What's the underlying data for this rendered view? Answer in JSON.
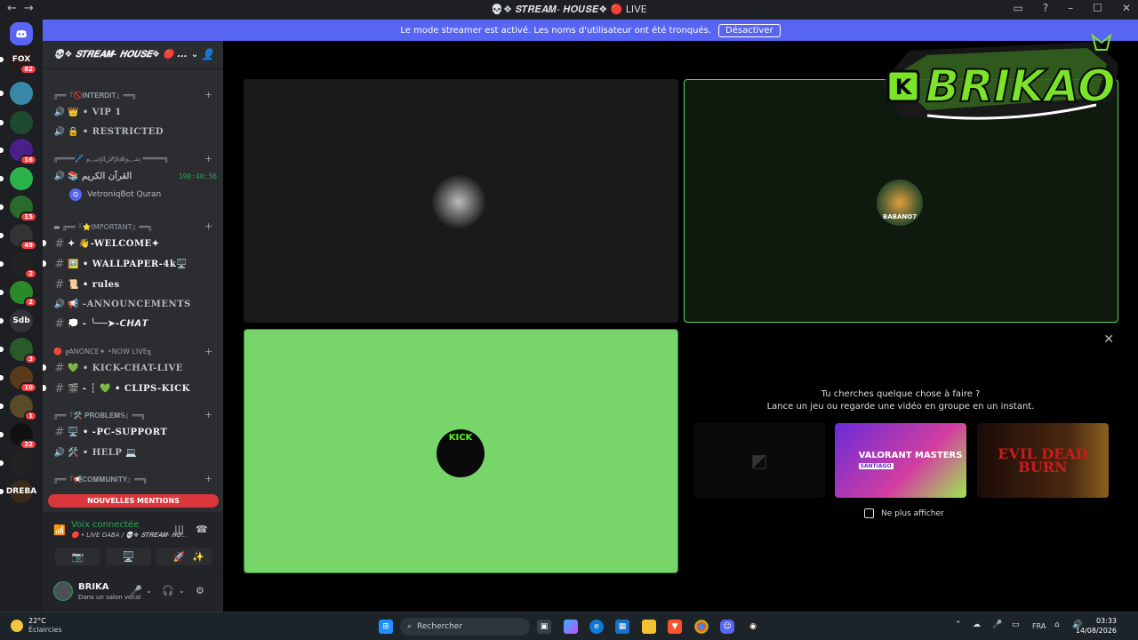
{
  "window": {
    "title": "💀❖ 𝑺𝑻𝑹𝑬𝑨𝑴- 𝑯𝑶𝑼𝑺𝑬❖ 🔴 LIVE",
    "nav_back": "←",
    "nav_forward": "→",
    "controls": [
      "▭",
      "?",
      "–",
      "☐",
      "✕"
    ]
  },
  "banner": {
    "text": "Le mode streamer est activé. Les noms d'utilisateur ont été tronqués.",
    "button": "Désactiver"
  },
  "guilds": [
    {
      "label": "FOX",
      "badge": "82",
      "color": "#2a1a1a"
    },
    {
      "label": "",
      "badge": "",
      "color": "#3a88a8"
    },
    {
      "label": "",
      "badge": "",
      "color": "#1e4a30"
    },
    {
      "label": "",
      "badge": "16",
      "color": "#4a1f8a"
    },
    {
      "label": "",
      "badge": "",
      "color": "#2bb24a"
    },
    {
      "label": "",
      "badge": "15",
      "color": "#2a6a2a"
    },
    {
      "label": "",
      "badge": "49",
      "color": "#333"
    },
    {
      "label": "",
      "badge": "2",
      "color": "#222"
    },
    {
      "label": "",
      "badge": "2",
      "color": "#2a8a2a"
    },
    {
      "label": "Sdb",
      "badge": "",
      "color": "#313338"
    },
    {
      "label": "",
      "badge": "3",
      "color": "#2a5a2a"
    },
    {
      "label": "",
      "badge": "10",
      "color": "#5a3a1a"
    },
    {
      "label": "",
      "badge": "1",
      "color": "#5a4a2a"
    },
    {
      "label": "",
      "badge": "22",
      "color": "#111"
    },
    {
      "label": "",
      "badge": "",
      "color": "#222"
    },
    {
      "label": "DREBA",
      "badge": "",
      "color": "#3a2a1a"
    }
  ],
  "server": {
    "name": "💀❖ 𝑺𝑻𝑹𝑬𝑨𝑴- 𝑯𝑶𝑼𝑺𝑬❖ 🔴 ..."
  },
  "categories": [
    {
      "label": "╔══『🚫𝐈𝐍𝐓𝐄𝐑𝐃𝐈𝐓』══╗",
      "plus": "+"
    },
    {
      "label": "╔════🖊️ ﷽ ═════╗",
      "plus": "+"
    },
    {
      "label": "▬ ╔══『⭐IMPORTANT』══╗",
      "plus": "+"
    },
    {
      "label": "🔴 ╔ANONCE✦ •NOW LIVE╗",
      "plus": "+"
    },
    {
      "label": "╔══『🛠️ 𝐏𝐑𝐎𝐁𝐋𝐄𝐌𝐒』══╗",
      "plus": "+"
    },
    {
      "label": "╔══『📢𝐂𝐎𝐌𝐌𝐔𝐍𝐈𝐓𝐘』══╗",
      "plus": "+"
    }
  ],
  "channels": [
    {
      "icon": "🔊",
      "name": "👑 • VIP 1"
    },
    {
      "icon": "🔊",
      "name": "🔒 • RESTRICTED"
    },
    {
      "icon": "🔊",
      "name": "📚 القرآن الكريم",
      "timer": "190:40:56"
    },
    {
      "icon": "#",
      "name": "✦ 👋-WELCOME✦"
    },
    {
      "icon": "#",
      "name": "🖼️ • WALLPAPER-4k🖥️"
    },
    {
      "icon": "#",
      "name": "📜 • rules"
    },
    {
      "icon": "🔊",
      "name": "📢 -ANNOUNCEMENTS"
    },
    {
      "icon": "#",
      "name": "💭 - ╰──➤-𝘾𝙃𝘼𝙏"
    },
    {
      "icon": "#",
      "name": "💚 • KICK-CHAT-LIVE"
    },
    {
      "icon": "#",
      "name": "🎬 - ┆ 💚 • CLIPS-KICK"
    },
    {
      "icon": "#",
      "name": "🖥️ • -PC-SUPPORT"
    },
    {
      "icon": "🔊",
      "name": "🛠️ • HELP 💻"
    }
  ],
  "voice_member": "VetroniqBot Quran",
  "mentions_pill": "NOUVELLES MENTIONS",
  "voice_panel": {
    "status": "Voix connectée",
    "location": "🔴 • LIVE DABA / 💀❖ 𝑺𝑻𝑹𝑬𝑨𝑴- 𝑯𝑶...",
    "buttons": [
      "📷",
      "🖥️",
      "🚀",
      "✨"
    ]
  },
  "user_panel": {
    "name": "BRIKA",
    "status": "Dans un salon vocal"
  },
  "stage": {
    "tiles": [
      {
        "avatar_label": "",
        "avatar_color": "#555"
      },
      {
        "avatar_label": "BABANO7",
        "avatar_color": "#2a4a2a"
      },
      {
        "avatar_label": "KICK",
        "avatar_color": "#0a0a0a"
      }
    ],
    "logo_text": "BRIKAO",
    "logo_prefix": "K"
  },
  "activity": {
    "line1": "Tu cherches quelque chose à faire ?",
    "line2": "Lance un jeu ou regarde une vidéo en groupe en un instant.",
    "cards": [
      {
        "label": "◩"
      },
      {
        "label": "VALORANT MASTERS",
        "sub": "SANTIAGO"
      },
      {
        "label": "EVIL DEAD BURN"
      }
    ],
    "checkbox_label": "Ne plus afficher"
  },
  "taskbar": {
    "temperature": "22°C",
    "weather": "Éclaircies",
    "search_placeholder": "Rechercher",
    "lang": "FRA",
    "time": "03:33",
    "date": "14/08/2026"
  },
  "colors": {
    "accent": "#5865f2",
    "speaking": "#5ed26a",
    "mention": "#da373c",
    "connected": "#23a55a"
  }
}
